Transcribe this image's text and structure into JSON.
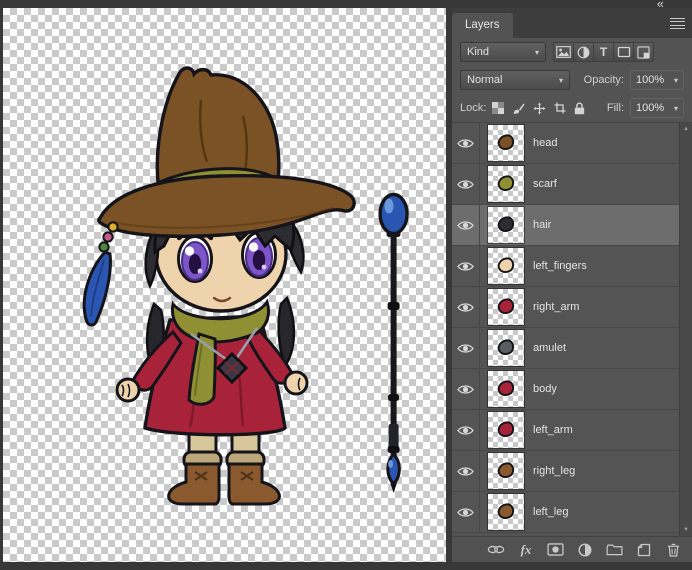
{
  "window": {
    "glyphs": {
      "collapse": "«",
      "chevron_down": "▾",
      "scroll_up": "▲",
      "scroll_down": "▼"
    }
  },
  "panel": {
    "tab_label": "Layers",
    "filter": {
      "kind_value": "Kind",
      "type_glyph": "T"
    },
    "blend": {
      "mode_value": "Normal",
      "opacity_label": "Opacity:",
      "opacity_value": "100%"
    },
    "lock": {
      "label": "Lock:",
      "fill_label": "Fill:",
      "fill_value": "100%"
    },
    "actions": {
      "fx_label": "fx"
    },
    "layers": [
      {
        "name": "head",
        "selected": false,
        "thumb_color": "#7a5226"
      },
      {
        "name": "scarf",
        "selected": false,
        "thumb_color": "#8f9033"
      },
      {
        "name": "hair",
        "selected": true,
        "thumb_color": "#2c2c31"
      },
      {
        "name": "left_fingers",
        "selected": false,
        "thumb_color": "#efd3ac"
      },
      {
        "name": "right_arm",
        "selected": false,
        "thumb_color": "#a8233a"
      },
      {
        "name": "amulet",
        "selected": false,
        "thumb_color": "#5b5b64"
      },
      {
        "name": "body",
        "selected": false,
        "thumb_color": "#a8233a"
      },
      {
        "name": "left_arm",
        "selected": false,
        "thumb_color": "#a8233a"
      },
      {
        "name": "right_leg",
        "selected": false,
        "thumb_color": "#8a5a2e"
      },
      {
        "name": "left_leg",
        "selected": false,
        "thumb_color": "#8a5a2e"
      }
    ]
  },
  "colors": {
    "panel_bg": "#535353",
    "selected_row_bg": "#6d6d6d",
    "canvas_checker": "#cacaca",
    "dress_red": "#a8233a",
    "scarf_olive": "#8f9033",
    "hat_brown": "#7a5226",
    "staff_blue": "#2a56b2",
    "eye_purple": "#7d55c8"
  }
}
